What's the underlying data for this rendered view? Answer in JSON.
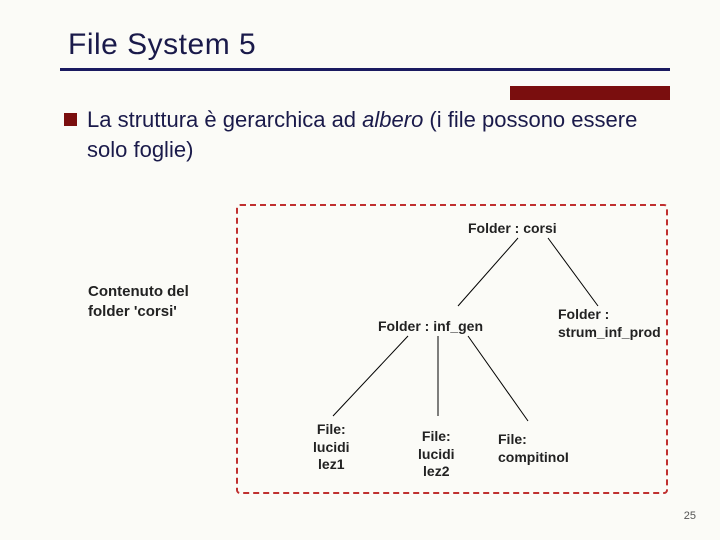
{
  "title": "File System  5",
  "bullet": {
    "pre": "La struttura è gerarchica ad ",
    "italic": "albero",
    "post": " (i file possono essere solo foglie)"
  },
  "caption": {
    "line1": "Contenuto del",
    "line2": "folder 'corsi'"
  },
  "nodes": {
    "root": "Folder : corsi",
    "inf_gen": "Folder : inf_gen",
    "strum_l1": "Folder :",
    "strum_l2": "strum_inf_prod",
    "f1_l1": "File:",
    "f1_l2": "lucidi",
    "f1_l3": "lez1",
    "f2_l1": "File:",
    "f2_l2": "lucidi",
    "f2_l3": "lez2",
    "f3_l1": "File:",
    "f3_l2": "compitinoI"
  },
  "page": "25"
}
